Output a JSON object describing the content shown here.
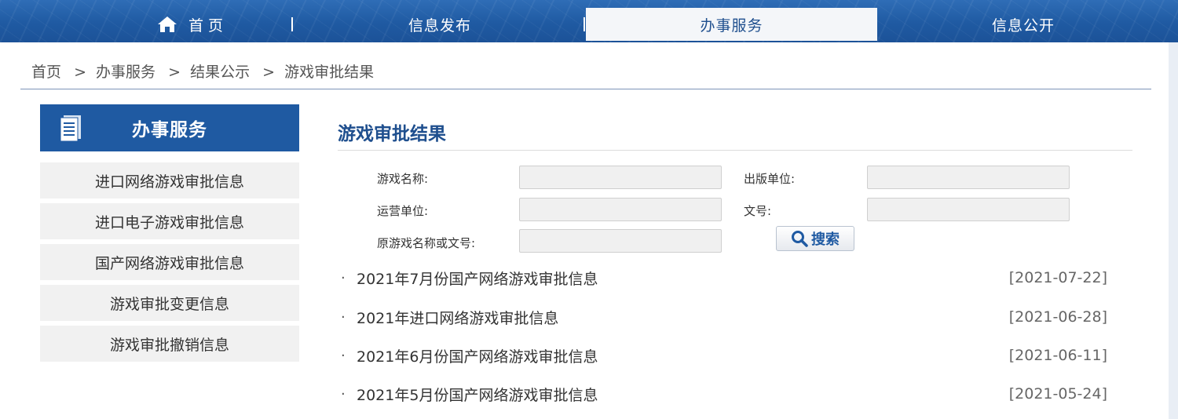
{
  "nav": {
    "home": "首页",
    "publish": "信息发布",
    "service": "办事服务",
    "open": "信息公开"
  },
  "breadcrumb": [
    "首页",
    "办事服务",
    "结果公示",
    "游戏审批结果"
  ],
  "breadcrumb_sep": ">",
  "sidebar": {
    "title": "办事服务",
    "items": [
      {
        "label": "进口网络游戏审批信息"
      },
      {
        "label": "进口电子游戏审批信息"
      },
      {
        "label": "国产网络游戏审批信息"
      },
      {
        "label": "游戏审批变更信息"
      },
      {
        "label": "游戏审批撤销信息"
      }
    ]
  },
  "content": {
    "title": "游戏审批结果",
    "form": {
      "game_name_label": "游戏名称:",
      "game_name_value": "",
      "publisher_label": "出版单位:",
      "publisher_value": "",
      "operator_label": "运营单位:",
      "operator_value": "",
      "doc_no_label": "文号:",
      "doc_no_value": "",
      "original_label": "原游戏名称或文号:",
      "original_value": "",
      "search_label": "搜索"
    },
    "list": [
      {
        "title": "2021年7月份国产网络游戏审批信息",
        "date": "[2021-07-22]"
      },
      {
        "title": "2021年进口网络游戏审批信息",
        "date": "[2021-06-28]"
      },
      {
        "title": "2021年6月份国产网络游戏审批信息",
        "date": "[2021-06-11]"
      },
      {
        "title": "2021年5月份国产网络游戏审批信息",
        "date": "[2021-05-24]"
      }
    ],
    "bullet": "·"
  },
  "icons": {
    "home": "home-icon",
    "sidebar": "document-icon",
    "search": "magnifier-icon"
  },
  "colors": {
    "brand": "#1f5aa2",
    "title": "#1f4f8e"
  }
}
